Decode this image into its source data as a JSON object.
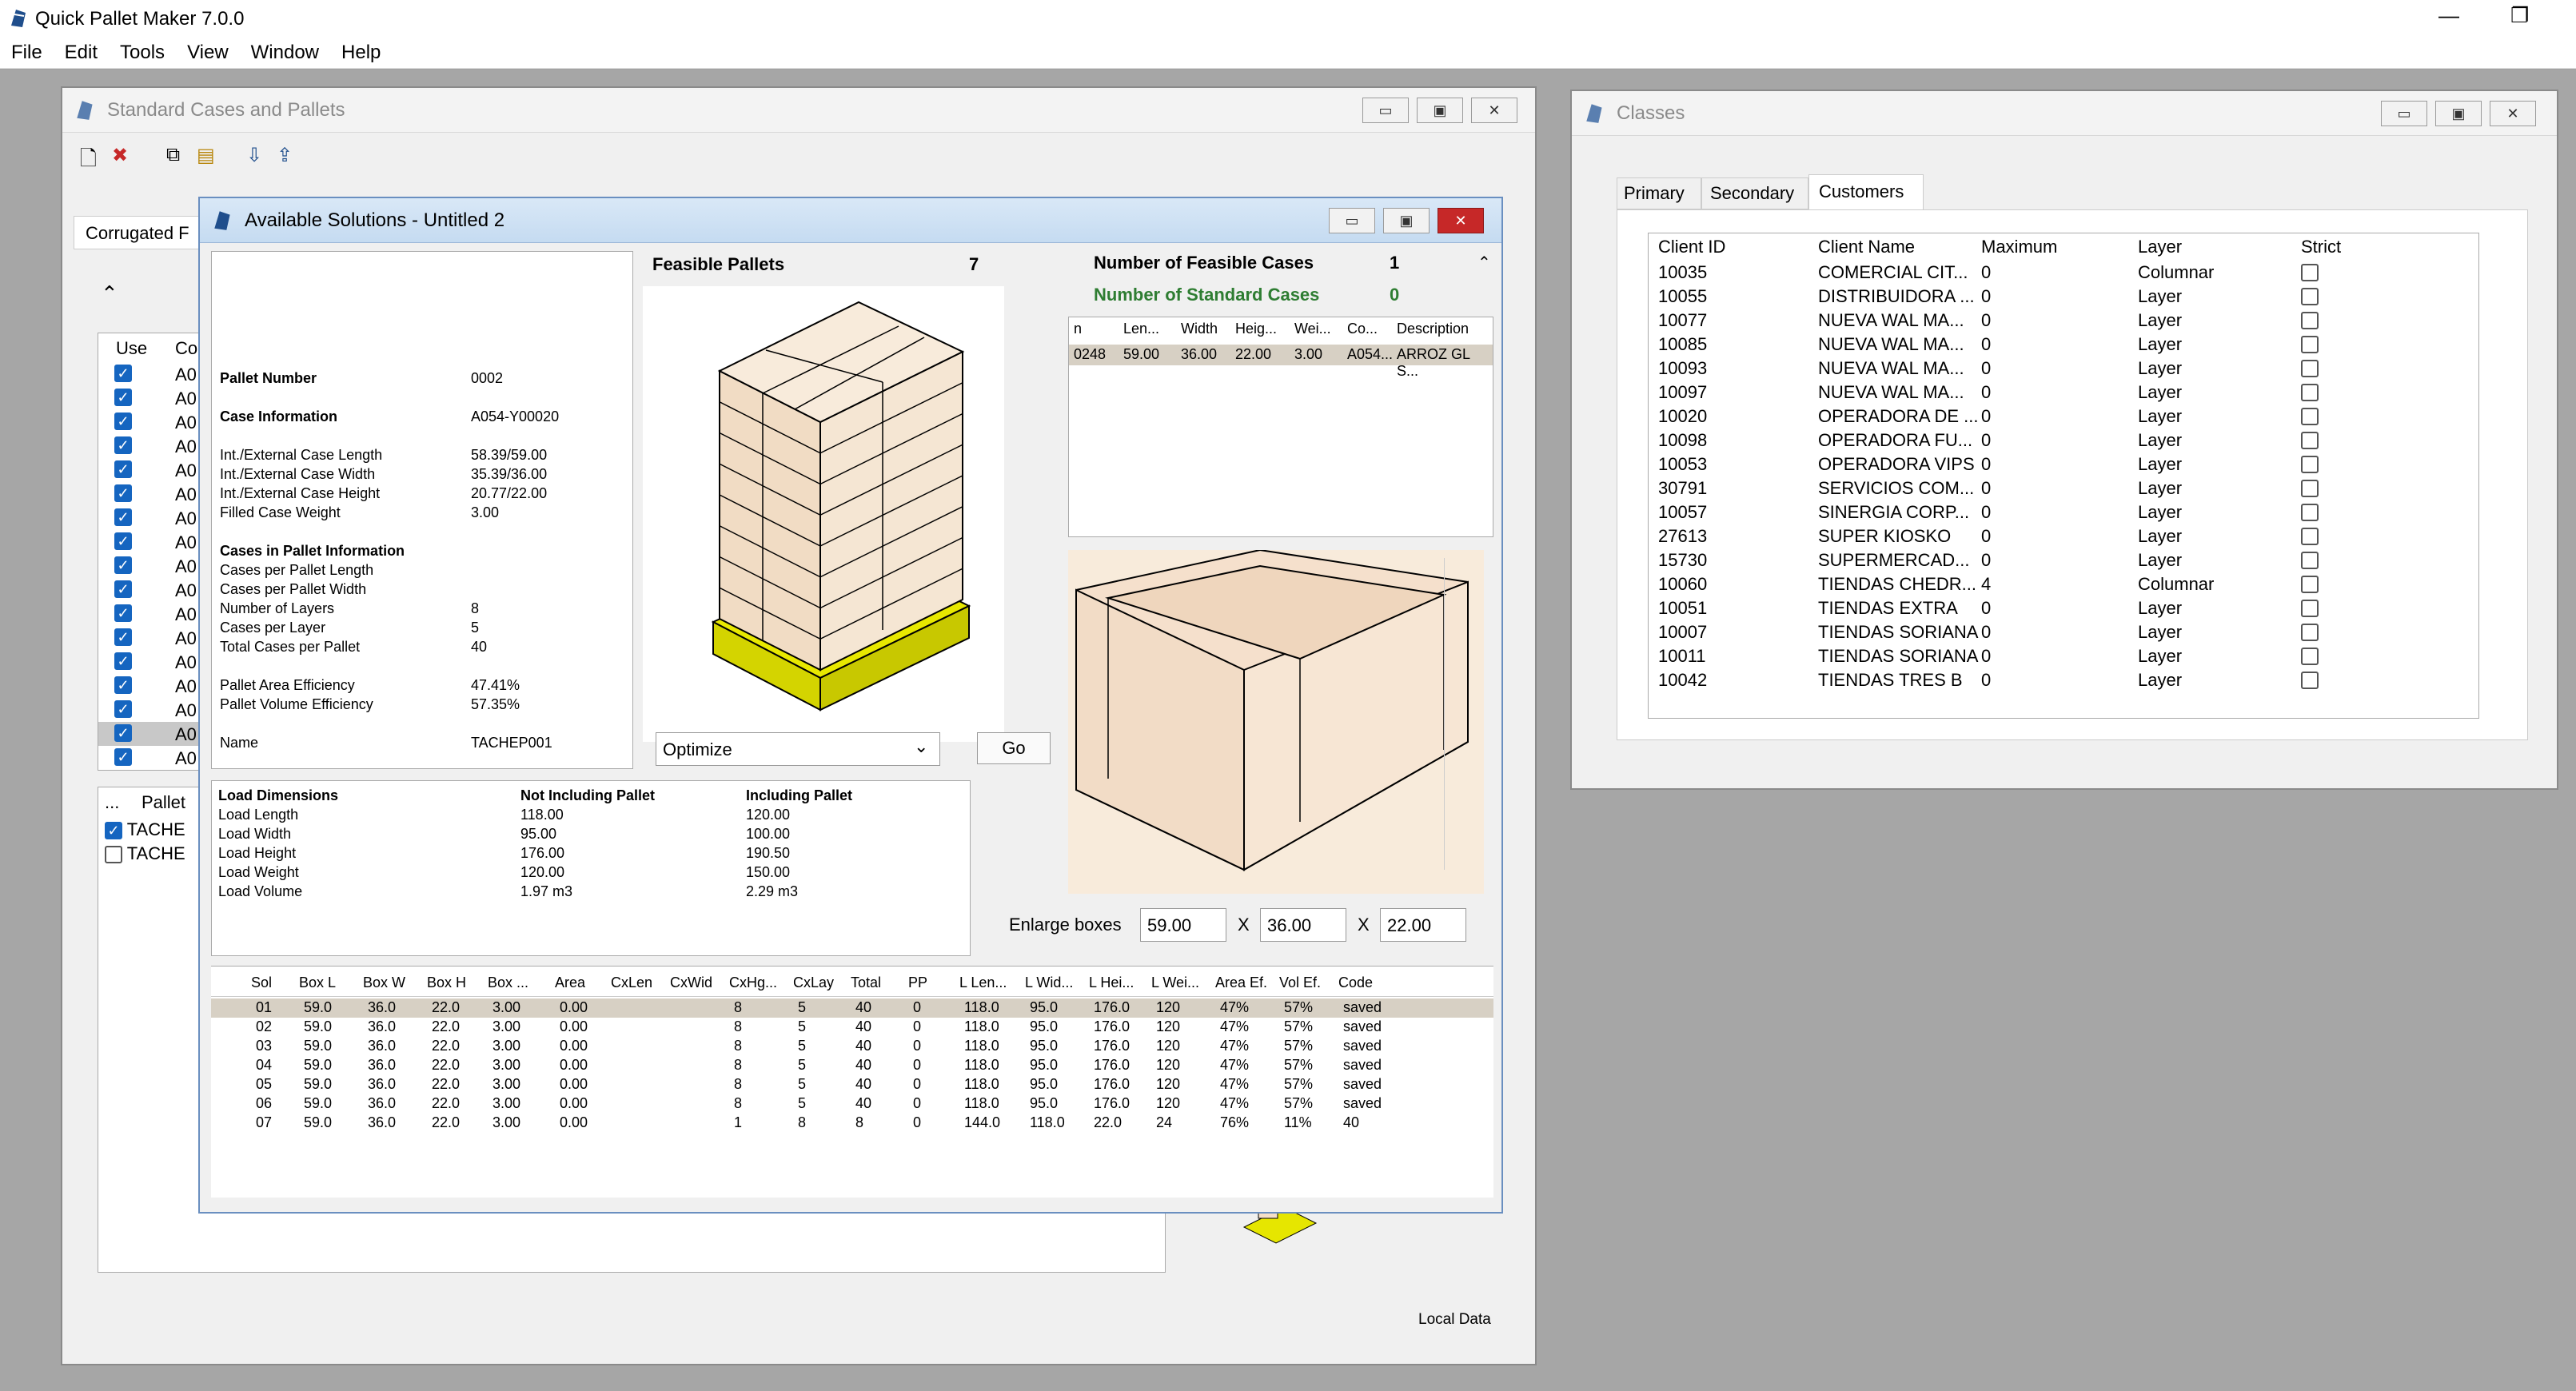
{
  "app": {
    "title": "Quick Pallet Maker 7.0.0",
    "menu": [
      "File",
      "Edit",
      "Tools",
      "View",
      "Window",
      "Help"
    ]
  },
  "std_window": {
    "title": "Standard Cases and Pallets",
    "tab_label": "Corrugated F",
    "use_header": "Use",
    "co_header": "Co",
    "rows": [
      "A0",
      "A0",
      "A0",
      "A0",
      "A0",
      "A0",
      "A0",
      "A0",
      "A0",
      "A0",
      "A0",
      "A0",
      "A0",
      "A0",
      "A0",
      "A0",
      "A0"
    ],
    "pallet_header_dots": "...",
    "pallet_header": "Pallet",
    "pallets": [
      "TACHE",
      "TACHE"
    ],
    "status": "Local Data"
  },
  "classes_window": {
    "title": "Classes",
    "tabs": [
      "Primary",
      "Secondary",
      "Customers"
    ],
    "columns": [
      "Client ID",
      "Client Name",
      "Maximum",
      "Layer",
      "Strict"
    ],
    "rows": [
      [
        "10035",
        "COMERCIAL CIT...",
        "0",
        "Columnar"
      ],
      [
        "10055",
        "DISTRIBUIDORA ...",
        "0",
        "Layer"
      ],
      [
        "10077",
        "NUEVA WAL MA...",
        "0",
        "Layer"
      ],
      [
        "10085",
        "NUEVA WAL MA...",
        "0",
        "Layer"
      ],
      [
        "10093",
        "NUEVA WAL MA...",
        "0",
        "Layer"
      ],
      [
        "10097",
        "NUEVA WAL MA...",
        "0",
        "Layer"
      ],
      [
        "10020",
        "OPERADORA DE ...",
        "0",
        "Layer"
      ],
      [
        "10098",
        "OPERADORA FU...",
        "0",
        "Layer"
      ],
      [
        "10053",
        "OPERADORA VIPS",
        "0",
        "Layer"
      ],
      [
        "30791",
        "SERVICIOS COM...",
        "0",
        "Layer"
      ],
      [
        "10057",
        "SINERGIA CORP...",
        "0",
        "Layer"
      ],
      [
        "27613",
        "SUPER KIOSKO",
        "0",
        "Layer"
      ],
      [
        "15730",
        "SUPERMERCAD...",
        "0",
        "Layer"
      ],
      [
        "10060",
        "TIENDAS CHEDR...",
        "4",
        "Columnar"
      ],
      [
        "10051",
        "TIENDAS EXTRA",
        "0",
        "Layer"
      ],
      [
        "10007",
        "TIENDAS SORIANA",
        "0",
        "Layer"
      ],
      [
        "10011",
        "TIENDAS SORIANA",
        "0",
        "Layer"
      ],
      [
        "10042",
        "TIENDAS TRES B",
        "0",
        "Layer"
      ]
    ]
  },
  "solutions_window": {
    "title": "Available Solutions - Untitled 2",
    "info": [
      {
        "label": "Pallet Number",
        "value": "0002",
        "bold": true
      },
      {
        "label": "",
        "value": ""
      },
      {
        "label": "Case Information",
        "value": "A054-Y00020",
        "bold": true
      },
      {
        "label": "",
        "value": ""
      },
      {
        "label": "Int./External Case Length",
        "value": "58.39/59.00"
      },
      {
        "label": "Int./External Case Width",
        "value": "35.39/36.00"
      },
      {
        "label": "Int./External Case Height",
        "value": "20.77/22.00"
      },
      {
        "label": "Filled Case Weight",
        "value": "3.00"
      },
      {
        "label": "",
        "value": ""
      },
      {
        "label": "Cases in Pallet Information",
        "value": "",
        "bold": true
      },
      {
        "label": "Cases per Pallet Length",
        "value": ""
      },
      {
        "label": "Cases per Pallet Width",
        "value": ""
      },
      {
        "label": "Number of Layers",
        "value": "8"
      },
      {
        "label": "Cases per Layer",
        "value": "5"
      },
      {
        "label": "Total Cases per Pallet",
        "value": "40"
      },
      {
        "label": "",
        "value": ""
      },
      {
        "label": "Pallet Area Efficiency",
        "value": "47.41%"
      },
      {
        "label": "Pallet Volume Efficiency",
        "value": "57.35%"
      },
      {
        "label": "",
        "value": ""
      },
      {
        "label": "Name",
        "value": "TACHEP001"
      }
    ],
    "feasible_pallets_label": "Feasible Pallets",
    "feasible_pallets_count": "7",
    "feasible_cases_label": "Number of Feasible Cases",
    "feasible_cases_count": "1",
    "standard_cases_label": "Number of Standard Cases",
    "standard_cases_count": "0",
    "case_columns": [
      "n",
      "Len...",
      "Width",
      "Heig...",
      "Wei...",
      "Co...",
      "Description"
    ],
    "case_rows": [
      [
        "0248",
        "59.00",
        "36.00",
        "22.00",
        "3.00",
        "A054...",
        "ARROZ GL S..."
      ]
    ],
    "optimize_value": "Optimize",
    "go_label": "Go",
    "enlarge_label": "Enlarge boxes",
    "enlarge_x_sep": "X",
    "enlarge": [
      "59.00",
      "36.00",
      "22.00"
    ],
    "load_headers": [
      "Load Dimensions",
      "Not Including Pallet",
      "Including Pallet"
    ],
    "load_rows": [
      [
        "Load Length",
        "118.00",
        "120.00"
      ],
      [
        "Load Width",
        "95.00",
        "100.00"
      ],
      [
        "Load Height",
        "176.00",
        "190.50"
      ],
      [
        "Load Weight",
        "120.00",
        "150.00"
      ],
      [
        "Load Volume",
        "1.97 m3",
        "2.29 m3"
      ]
    ],
    "sol_columns": [
      "Sol",
      "Box L",
      "Box W",
      "Box H",
      "Box ...",
      "Area",
      "CxLen",
      "CxWid",
      "CxHg...",
      "CxLay",
      "Total",
      "PP",
      "L Len...",
      "L Wid...",
      "L Hei...",
      "L Wei...",
      "Area Ef.",
      "Vol Ef.",
      "Code"
    ],
    "sol_rows": [
      [
        "01",
        "59.0",
        "36.0",
        "22.0",
        "3.00",
        "0.00",
        "",
        "",
        "8",
        "5",
        "40",
        "0",
        "118.0",
        "95.0",
        "176.0",
        "120",
        "47%",
        "57%",
        "saved"
      ],
      [
        "02",
        "59.0",
        "36.0",
        "22.0",
        "3.00",
        "0.00",
        "",
        "",
        "8",
        "5",
        "40",
        "0",
        "118.0",
        "95.0",
        "176.0",
        "120",
        "47%",
        "57%",
        "saved"
      ],
      [
        "03",
        "59.0",
        "36.0",
        "22.0",
        "3.00",
        "0.00",
        "",
        "",
        "8",
        "5",
        "40",
        "0",
        "118.0",
        "95.0",
        "176.0",
        "120",
        "47%",
        "57%",
        "saved"
      ],
      [
        "04",
        "59.0",
        "36.0",
        "22.0",
        "3.00",
        "0.00",
        "",
        "",
        "8",
        "5",
        "40",
        "0",
        "118.0",
        "95.0",
        "176.0",
        "120",
        "47%",
        "57%",
        "saved"
      ],
      [
        "05",
        "59.0",
        "36.0",
        "22.0",
        "3.00",
        "0.00",
        "",
        "",
        "8",
        "5",
        "40",
        "0",
        "118.0",
        "95.0",
        "176.0",
        "120",
        "47%",
        "57%",
        "saved"
      ],
      [
        "06",
        "59.0",
        "36.0",
        "22.0",
        "3.00",
        "0.00",
        "",
        "",
        "8",
        "5",
        "40",
        "0",
        "118.0",
        "95.0",
        "176.0",
        "120",
        "47%",
        "57%",
        "saved"
      ],
      [
        "07",
        "59.0",
        "36.0",
        "22.0",
        "3.00",
        "0.00",
        "",
        "",
        "1",
        "8",
        "8",
        "0",
        "144.0",
        "118.0",
        "22.0",
        "24",
        "76%",
        "11%",
        "40"
      ]
    ]
  }
}
